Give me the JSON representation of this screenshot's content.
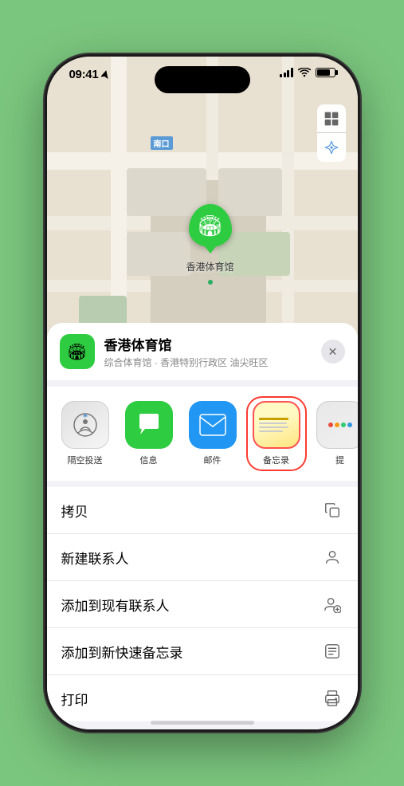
{
  "status_bar": {
    "time": "09:41",
    "time_icon": "location-arrow-icon"
  },
  "map": {
    "label_district": "南口",
    "district_prefix": "南口"
  },
  "controls": {
    "map_icon": "🗺",
    "location_icon": "↗"
  },
  "marker": {
    "label": "香港体育馆"
  },
  "location_card": {
    "name": "香港体育馆",
    "description": "综合体育馆 · 香港特别行政区 油尖旺区",
    "close_label": "✕"
  },
  "share_apps": [
    {
      "id": "airdrop",
      "label": "隔空投送"
    },
    {
      "id": "messages",
      "label": "信息"
    },
    {
      "id": "mail",
      "label": "邮件"
    },
    {
      "id": "notes",
      "label": "备忘录"
    },
    {
      "id": "more",
      "label": "提"
    }
  ],
  "actions": [
    {
      "id": "copy",
      "label": "拷贝",
      "icon": "copy"
    },
    {
      "id": "new-contact",
      "label": "新建联系人",
      "icon": "person"
    },
    {
      "id": "add-existing",
      "label": "添加到现有联系人",
      "icon": "person-add"
    },
    {
      "id": "add-notes",
      "label": "添加到新快速备忘录",
      "icon": "note"
    },
    {
      "id": "print",
      "label": "打印",
      "icon": "printer"
    }
  ]
}
